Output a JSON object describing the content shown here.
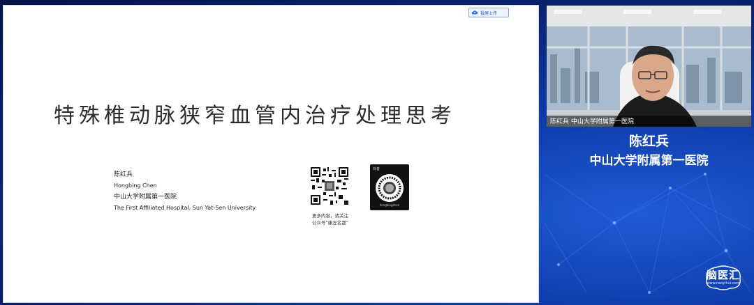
{
  "slide": {
    "upload_label": "投屏上传",
    "title": "特殊椎动脉狭窄血管内治疗处理思考",
    "author_cn": "陈红兵",
    "author_en": "Hongbing Chen",
    "hospital_cn": "中山大学附属第一医院",
    "hospital_en": "The First Affiliated Hospital, Sun Yat-Sen University",
    "qr_caption_line1": "更多内容，请关注",
    "qr_caption_line2": "公众号“康左名都”",
    "douyin_label": "抖音",
    "douyin_id": "hongbingchen"
  },
  "speaker": {
    "video_caption": "陈红兵  中山大学附属第一医院",
    "name": "陈红兵",
    "organization": "中山大学附属第一医院"
  },
  "brand": {
    "logo_text": "脑医汇",
    "logo_sub": "www.naoyihui.com"
  },
  "colors": {
    "background": "#0a2a78",
    "slide_bg": "#ffffff",
    "accent": "#2a5ab8"
  }
}
